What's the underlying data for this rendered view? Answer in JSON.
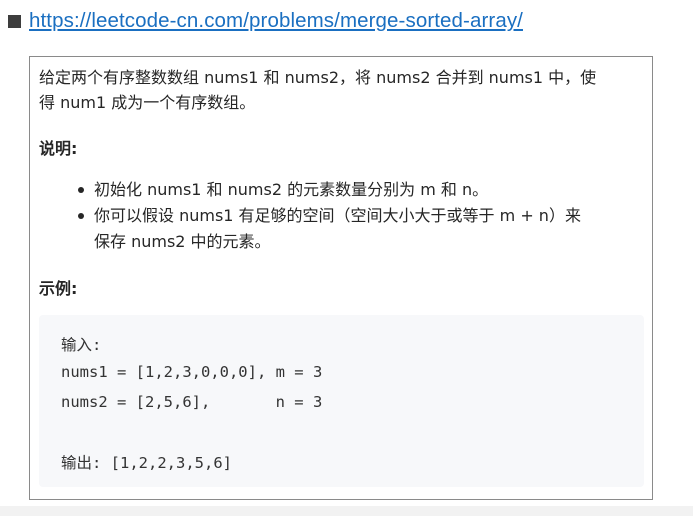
{
  "url": "https://leetcode-cn.com/problems/merge-sorted-array/",
  "description": {
    "line1": "给定两个有序整数数组 nums1 和 nums2，将 nums2 合并到 nums1 中，使",
    "line2": "得 num1 成为一个有序数组。"
  },
  "notes_title": "说明:",
  "notes": [
    {
      "line1": "初始化 nums1 和 nums2 的元素数量分别为 m 和 n。"
    },
    {
      "line1": "你可以假设 nums1 有足够的空间（空间大小大于或等于 m + n）来",
      "line2": "保存 nums2 中的元素。"
    }
  ],
  "example_title": "示例:",
  "example": {
    "input_label": "输入:",
    "line_nums1": "nums1 = [1,2,3,0,0,0], m = 3",
    "line_nums2": "nums2 = [2,5,6],       n = 3",
    "output_line": "输出: [1,2,2,3,5,6]"
  }
}
